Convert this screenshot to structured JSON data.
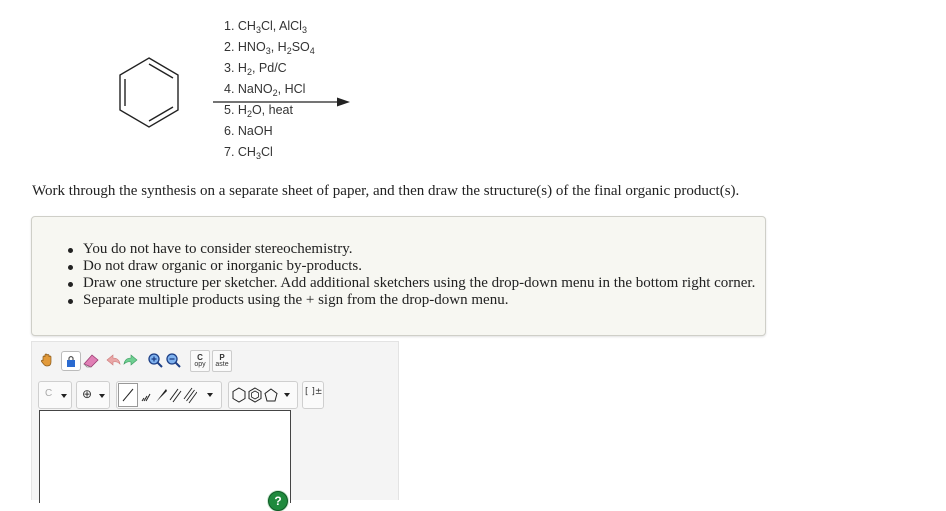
{
  "reaction": {
    "steps": [
      {
        "n": "1.",
        "parts": [
          [
            "CH",
            "t"
          ],
          [
            "3",
            "s"
          ],
          [
            "Cl, AlCl",
            "t"
          ],
          [
            "3",
            "s"
          ]
        ]
      },
      {
        "n": "2.",
        "parts": [
          [
            "HNO",
            "t"
          ],
          [
            "3",
            "s"
          ],
          [
            ", H",
            "t"
          ],
          [
            "2",
            "s"
          ],
          [
            "SO",
            "t"
          ],
          [
            "4",
            "s"
          ]
        ]
      },
      {
        "n": "3.",
        "parts": [
          [
            "H",
            "t"
          ],
          [
            "2",
            "s"
          ],
          [
            ", Pd/C",
            "t"
          ]
        ]
      },
      {
        "n": "4.",
        "parts": [
          [
            "NaNO",
            "t"
          ],
          [
            "2",
            "s"
          ],
          [
            ", HCl",
            "t"
          ]
        ]
      },
      {
        "n": "5.",
        "parts": [
          [
            "H",
            "t"
          ],
          [
            "2",
            "s"
          ],
          [
            "O, heat",
            "t"
          ]
        ]
      },
      {
        "n": "6.",
        "parts": [
          [
            "NaOH",
            "t"
          ]
        ]
      },
      {
        "n": "7.",
        "parts": [
          [
            "CH",
            "t"
          ],
          [
            "3",
            "s"
          ],
          [
            "Cl",
            "t"
          ]
        ]
      }
    ]
  },
  "instruction": "Work through the synthesis on a separate sheet of paper, and then draw the structure(s) of the final organic product(s).",
  "hints": [
    "You do not have to consider stereochemistry.",
    "Do not draw organic or inorganic by-products.",
    "Draw one structure per sketcher. Add additional sketchers using the drop-down menu in the bottom right corner.",
    "Separate multiple products using the + sign from the drop-down menu."
  ],
  "sketcher": {
    "atom_value": "C",
    "copy_label_top": "C",
    "copy_label_bottom": "opy",
    "paste_label_top": "P",
    "paste_label_bottom": "aste",
    "charge_symbol": "⊕",
    "bracket_label": "[ ]±",
    "help_symbol": "?"
  },
  "colors": {
    "help_green": "#1f8a3d",
    "hint_bg": "#f7f7f2"
  },
  "icons": [
    "hand-icon",
    "lasso-icon",
    "eraser-icon",
    "undo-icon",
    "redo-icon",
    "zoom-in-icon",
    "zoom-out-icon",
    "help-icon"
  ]
}
